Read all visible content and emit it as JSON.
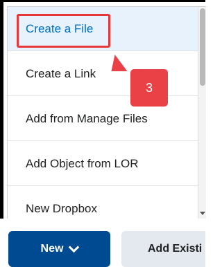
{
  "menu": {
    "items": [
      {
        "label": "Create a File"
      },
      {
        "label": "Create a Link"
      },
      {
        "label": "Add from Manage Files"
      },
      {
        "label": "Add Object from LOR"
      },
      {
        "label": "New Dropbox"
      }
    ]
  },
  "annotation": {
    "step": "3",
    "color": "#ea4146"
  },
  "toolbar": {
    "new_label": "New",
    "add_existing_label": "Add Existi"
  },
  "colors": {
    "primary_button": "#004a92",
    "selected_item_text": "#006fbf",
    "annotation": "#e4383b"
  }
}
